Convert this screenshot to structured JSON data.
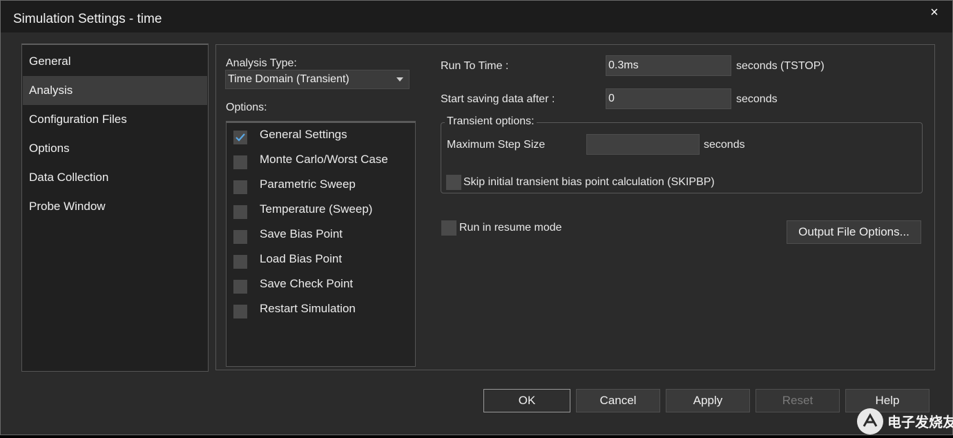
{
  "window": {
    "title": "Simulation Settings - time",
    "close_label": "×"
  },
  "nav": {
    "items": [
      {
        "label": "General",
        "selected": false
      },
      {
        "label": "Analysis",
        "selected": true
      },
      {
        "label": "Configuration Files",
        "selected": false
      },
      {
        "label": "Options",
        "selected": false
      },
      {
        "label": "Data Collection",
        "selected": false
      },
      {
        "label": "Probe Window",
        "selected": false
      }
    ]
  },
  "analysis": {
    "type_label": "Analysis Type:",
    "type_value": "Time Domain (Transient)",
    "options_label": "Options:",
    "options": [
      {
        "label": "General Settings",
        "checked": true
      },
      {
        "label": "Monte Carlo/Worst Case",
        "checked": false
      },
      {
        "label": "Parametric Sweep",
        "checked": false
      },
      {
        "label": "Temperature (Sweep)",
        "checked": false
      },
      {
        "label": "Save Bias Point",
        "checked": false
      },
      {
        "label": "Load Bias Point",
        "checked": false
      },
      {
        "label": "Save Check Point",
        "checked": false
      },
      {
        "label": "Restart Simulation",
        "checked": false
      }
    ]
  },
  "transient": {
    "run_to_time_label": "Run To Time :",
    "run_to_time_value": "0.3ms",
    "run_to_time_unit": "seconds (TSTOP)",
    "start_saving_label": "Start saving data after :",
    "start_saving_value": "0",
    "start_saving_unit": "seconds",
    "group_title": "Transient options:",
    "max_step_label": "Maximum Step Size",
    "max_step_value": "",
    "max_step_unit": "seconds",
    "skip_bias_label": "Skip initial transient bias point calculation (SKIPBP)",
    "skip_bias_checked": false,
    "resume_label": "Run in resume mode",
    "resume_checked": false,
    "output_file_button": "Output File Options..."
  },
  "buttons": {
    "ok": "OK",
    "cancel": "Cancel",
    "apply": "Apply",
    "reset": "Reset",
    "help": "Help"
  },
  "watermark": {
    "text": "电子发烧友"
  },
  "colors": {
    "check": "#5aa9e6",
    "background": "#2b2b2b",
    "titlebar": "#1c1c1c"
  }
}
